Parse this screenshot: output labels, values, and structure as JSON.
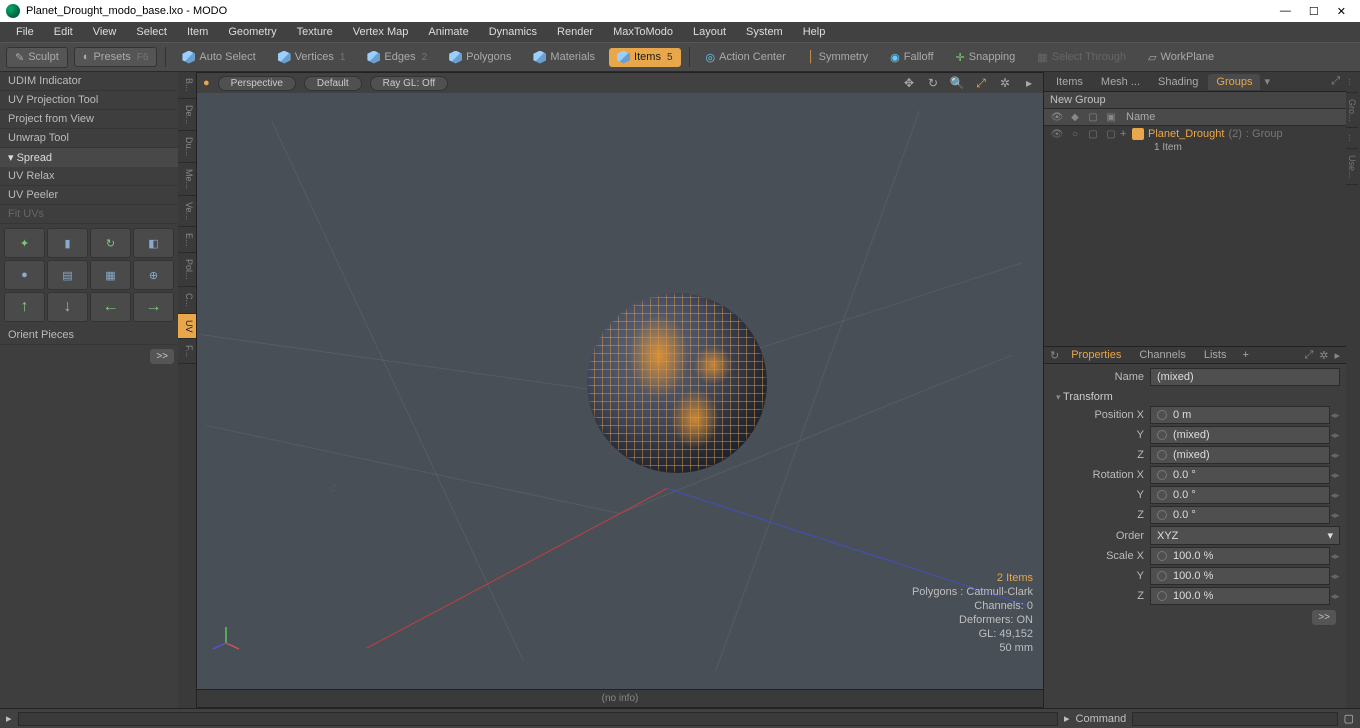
{
  "window": {
    "title": "Planet_Drought_modo_base.lxo - MODO"
  },
  "menu": [
    "File",
    "Edit",
    "View",
    "Select",
    "Item",
    "Geometry",
    "Texture",
    "Vertex Map",
    "Animate",
    "Dynamics",
    "Render",
    "MaxToModo",
    "Layout",
    "System",
    "Help"
  ],
  "toolbar": {
    "sculpt": "Sculpt",
    "presets": "Presets",
    "presets_key": "F6",
    "autoselect": "Auto Select",
    "vertices": "Vertices",
    "vertices_n": "1",
    "edges": "Edges",
    "edges_n": "2",
    "polygons": "Polygons",
    "materials": "Materials",
    "items": "Items",
    "items_n": "5",
    "actioncenter": "Action Center",
    "symmetry": "Symmetry",
    "falloff": "Falloff",
    "snapping": "Snapping",
    "selectthrough": "Select Through",
    "workplane": "WorkPlane"
  },
  "left": {
    "tools": [
      "UDIM Indicator",
      "UV Projection Tool",
      "Project from View",
      "Unwrap Tool"
    ],
    "spread_hdr": "Spread",
    "tools2": [
      "UV Relax",
      "UV Peeler"
    ],
    "fituvs": "Fit UVs",
    "orient": "Orient Pieces",
    "more": ">>",
    "tabs": [
      "B...",
      "De...",
      "Du...",
      "Me...",
      "Ve...",
      "E...",
      "Pol...",
      "C...",
      "UV",
      "F..."
    ]
  },
  "viewport": {
    "mode": "Perspective",
    "shading": "Default",
    "raygl": "Ray GL: Off",
    "zlabel": "-Z",
    "info_items": "2 Items",
    "info_poly": "Polygons : Catmull-Clark",
    "info_chan": "Channels: 0",
    "info_def": "Deformers: ON",
    "info_gl": "GL: 49,152",
    "info_size": "50 mm",
    "footer": "(no info)"
  },
  "right": {
    "tabs": [
      "Items",
      "Mesh ...",
      "Shading",
      "Groups"
    ],
    "newgroup": "New Group",
    "col_name": "Name",
    "group_name": "Planet_Drought",
    "group_count": "(2)",
    "group_type": ": Group",
    "group_sub": "1 Item",
    "prop_tabs": [
      "Properties",
      "Channels",
      "Lists"
    ],
    "name_label": "Name",
    "name_value": "(mixed)",
    "transform_hdr": "Transform",
    "pos_label": "Position X",
    "pos_x": "0 m",
    "y_label": "Y",
    "pos_y": "(mixed)",
    "z_label": "Z",
    "pos_z": "(mixed)",
    "rot_label": "Rotation X",
    "rot_x": "0.0 °",
    "rot_y": "0.0 °",
    "rot_z": "0.0 °",
    "order_label": "Order",
    "order_val": "XYZ",
    "scale_label": "Scale X",
    "scale_x": "100.0 %",
    "scale_y": "100.0 %",
    "scale_z": "100.0 %",
    "more": ">>",
    "strip": [
      "...",
      "Gro...",
      "...",
      "Use..."
    ]
  },
  "cmd": {
    "label": "Command"
  }
}
